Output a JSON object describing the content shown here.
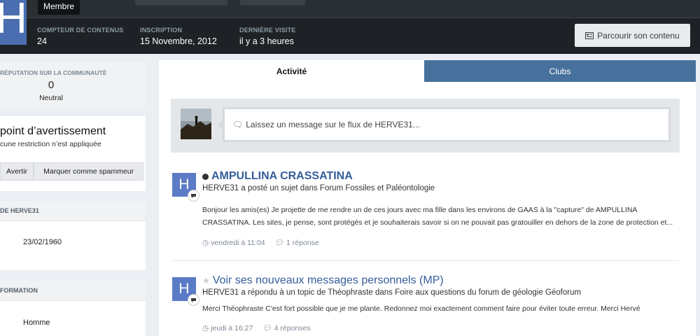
{
  "header": {
    "role_badge": "Membre",
    "avatar_letter": "H",
    "stats": [
      {
        "label": "COMPTEUR DE CONTENUS",
        "value": "24"
      },
      {
        "label": "INSCRIPTION",
        "value": "15 Novembre, 2012"
      },
      {
        "label": "DERNIÈRE VISITE",
        "value": "il y a 3 heures"
      }
    ],
    "browse_label": "Parcourir son contenu"
  },
  "sidebar": {
    "reputation": {
      "label": "RÉPUTATION SUR LA COMMUNAUTÉ",
      "value": "0",
      "status": "Neutral"
    },
    "warning": {
      "title": "point d’avertissement",
      "subtitle": "cune restriction n’est appliquée",
      "warn_label": "Avertir",
      "spam_label": "Marquer comme spammeur"
    },
    "about": {
      "heading": "DE HERVE31",
      "birthday": "23/02/1960"
    },
    "info": {
      "heading": "FORMATION",
      "gender": "Homme"
    }
  },
  "tabs": [
    {
      "label": "Activité",
      "active": true
    },
    {
      "label": "Clubs",
      "active": false
    }
  ],
  "composer": {
    "placeholder": "Laissez un message sur le flux de HERVE31..."
  },
  "feed": [
    {
      "avatar_letter": "H",
      "title": "AMPULLINA CRASSATINA",
      "meta": "HERVE31 a posté un sujet dans Forum Fossiles et Paléontologie",
      "body": "Bonjour les amis(es) Je projette de me rendre un de ces jours avec ma fille dans les environs de GAAS à la \"capture\" de AMPULLINA CRASSATINA. Les sites, je pense, sont protégés et je souhaiterais savoir si on ne pouvait pas gratouiller en dehors de la zone de protection et...",
      "time": "vendredi à 11:04",
      "replies": "1 réponse"
    },
    {
      "avatar_letter": "H",
      "title": "Voir ses nouveaux messages personnels (MP)",
      "meta": "HERVE31 a répondu à un topic de Théophraste dans Foire aux questions du forum de géologie Géoforum",
      "body": "Merci Théophraste C'est fort possible que je me plante. Redonnez moi exactement comment faire pour éviter toute erreur. Merci Hervé",
      "time": "jeudi à 16:27",
      "replies": "4 réponses"
    }
  ],
  "colors": {
    "tab_inactive": "#47719c",
    "title_link": "#355d9b",
    "avatar": "#5b7bc7"
  }
}
